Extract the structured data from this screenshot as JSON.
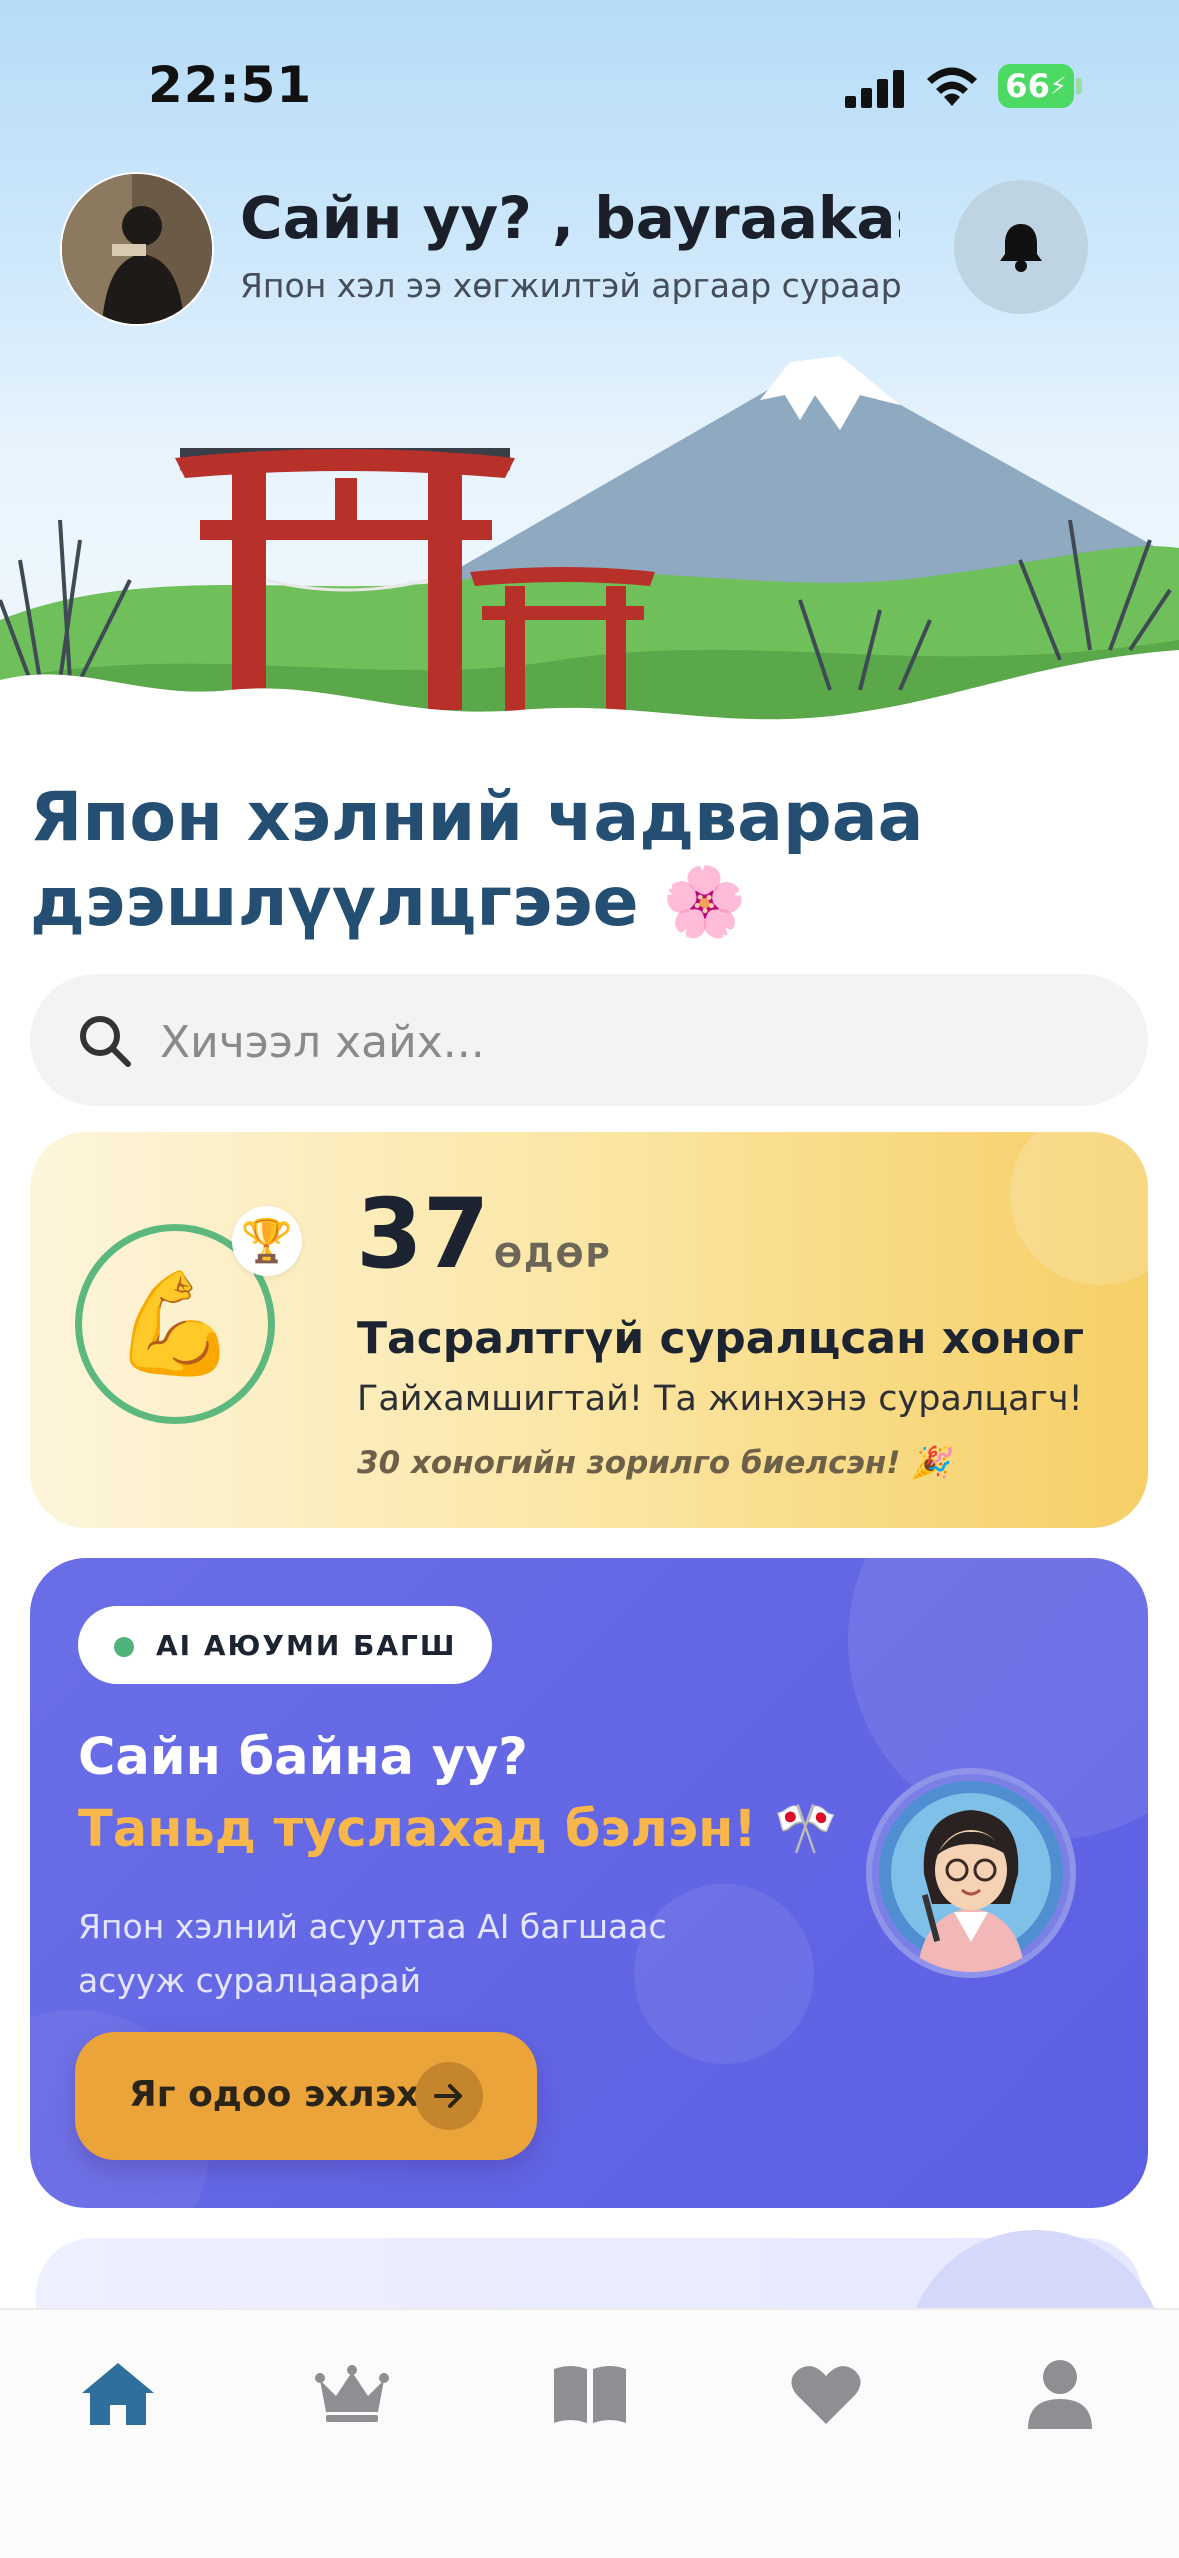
{
  "status_bar": {
    "time": "22:51",
    "battery": "66",
    "icons": [
      "cellular-signal-icon",
      "wifi-icon",
      "battery-charging-icon"
    ]
  },
  "header": {
    "greeting": "Сайн уу? , bayraakasp...",
    "subtitle": "Япон хэл ээ хөгжилтэй аргаар сураар...",
    "notification_icon": "bell-icon"
  },
  "main": {
    "title": "Япон хэлний чадвараа дээшлүүлцгээе 🌸",
    "search": {
      "placeholder": "Хичээл хайх..."
    }
  },
  "streak": {
    "emoji": "💪",
    "trophy": "🏆",
    "days": "37",
    "unit": "ӨДӨР",
    "title": "Тасралтгүй суралцсан хоног",
    "subtitle": "Гайхамшигтай! Та жинхэнэ суралцагч!",
    "goal": "30 хоногийн зорилго биелсэн! 🎉"
  },
  "ai_card": {
    "badge": "AI АЮУМИ БАГШ",
    "greeting": "Сайн байна уу?",
    "ready": "Таньд туслахад бэлэн! 🎌",
    "description": "Япон хэлний асуултаа AI багшаас асууж суралцаарай",
    "button_label": "Яг одоо эхлэх"
  },
  "tab_bar": {
    "items": [
      {
        "icon": "home-icon",
        "active": true
      },
      {
        "icon": "crown-icon",
        "active": false
      },
      {
        "icon": "book-icon",
        "active": false
      },
      {
        "icon": "heart-icon",
        "active": false
      },
      {
        "icon": "profile-icon",
        "active": false
      }
    ]
  },
  "colors": {
    "accent": "#2f6f9c",
    "title": "#244f73",
    "ai_card": "#6366e3",
    "ai_button": "#eaa43a",
    "streak_ring": "#5cb87f",
    "tab_inactive": "#8e8e93"
  }
}
